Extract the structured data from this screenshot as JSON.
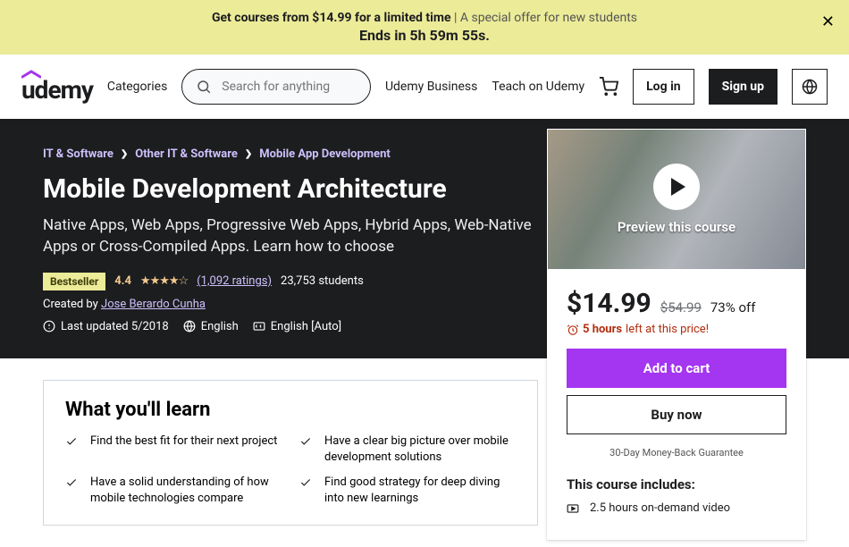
{
  "promo": {
    "line1_bold": "Get courses from $14.99 for a limited time",
    "line1_light": " | A special offer for new students",
    "line2": "Ends in 5h 59m 55s."
  },
  "header": {
    "logo": "udemy",
    "categories": "Categories",
    "search_placeholder": "Search for anything",
    "business": "Udemy Business",
    "teach": "Teach on Udemy",
    "login": "Log in",
    "signup": "Sign up"
  },
  "breadcrumbs": [
    "IT & Software",
    "Other IT & Software",
    "Mobile App Development"
  ],
  "course": {
    "title": "Mobile Development Architecture",
    "subtitle": "Native Apps, Web Apps, Progressive Web Apps, Hybrid Apps, Web-Native Apps or Cross-Compiled Apps. Learn how to choose",
    "bestseller": "Bestseller",
    "rating": "4.4",
    "ratings_count": "(1,092 ratings)",
    "students": "23,753 students",
    "created_by_prefix": "Created by ",
    "author": "Jose Berardo Cunha",
    "last_updated": "Last updated 5/2018",
    "language": "English",
    "captions": "English [Auto]"
  },
  "preview": {
    "label": "Preview this course"
  },
  "pricing": {
    "price": "$14.99",
    "original": "$54.99",
    "discount": "73% off",
    "timer_bold": "5 hours",
    "timer_rest": " left at this price!",
    "add_to_cart": "Add to cart",
    "buy_now": "Buy now",
    "guarantee": "30-Day Money-Back Guarantee"
  },
  "includes": {
    "title": "This course includes:",
    "item1": "2.5 hours on-demand video"
  },
  "learn": {
    "title": "What you'll learn",
    "items": [
      "Find the best fit for their next project",
      "Have a clear big picture over mobile development solutions",
      "Have a solid understanding of how mobile technologies compare",
      "Find good strategy for deep diving into new learnings"
    ]
  }
}
